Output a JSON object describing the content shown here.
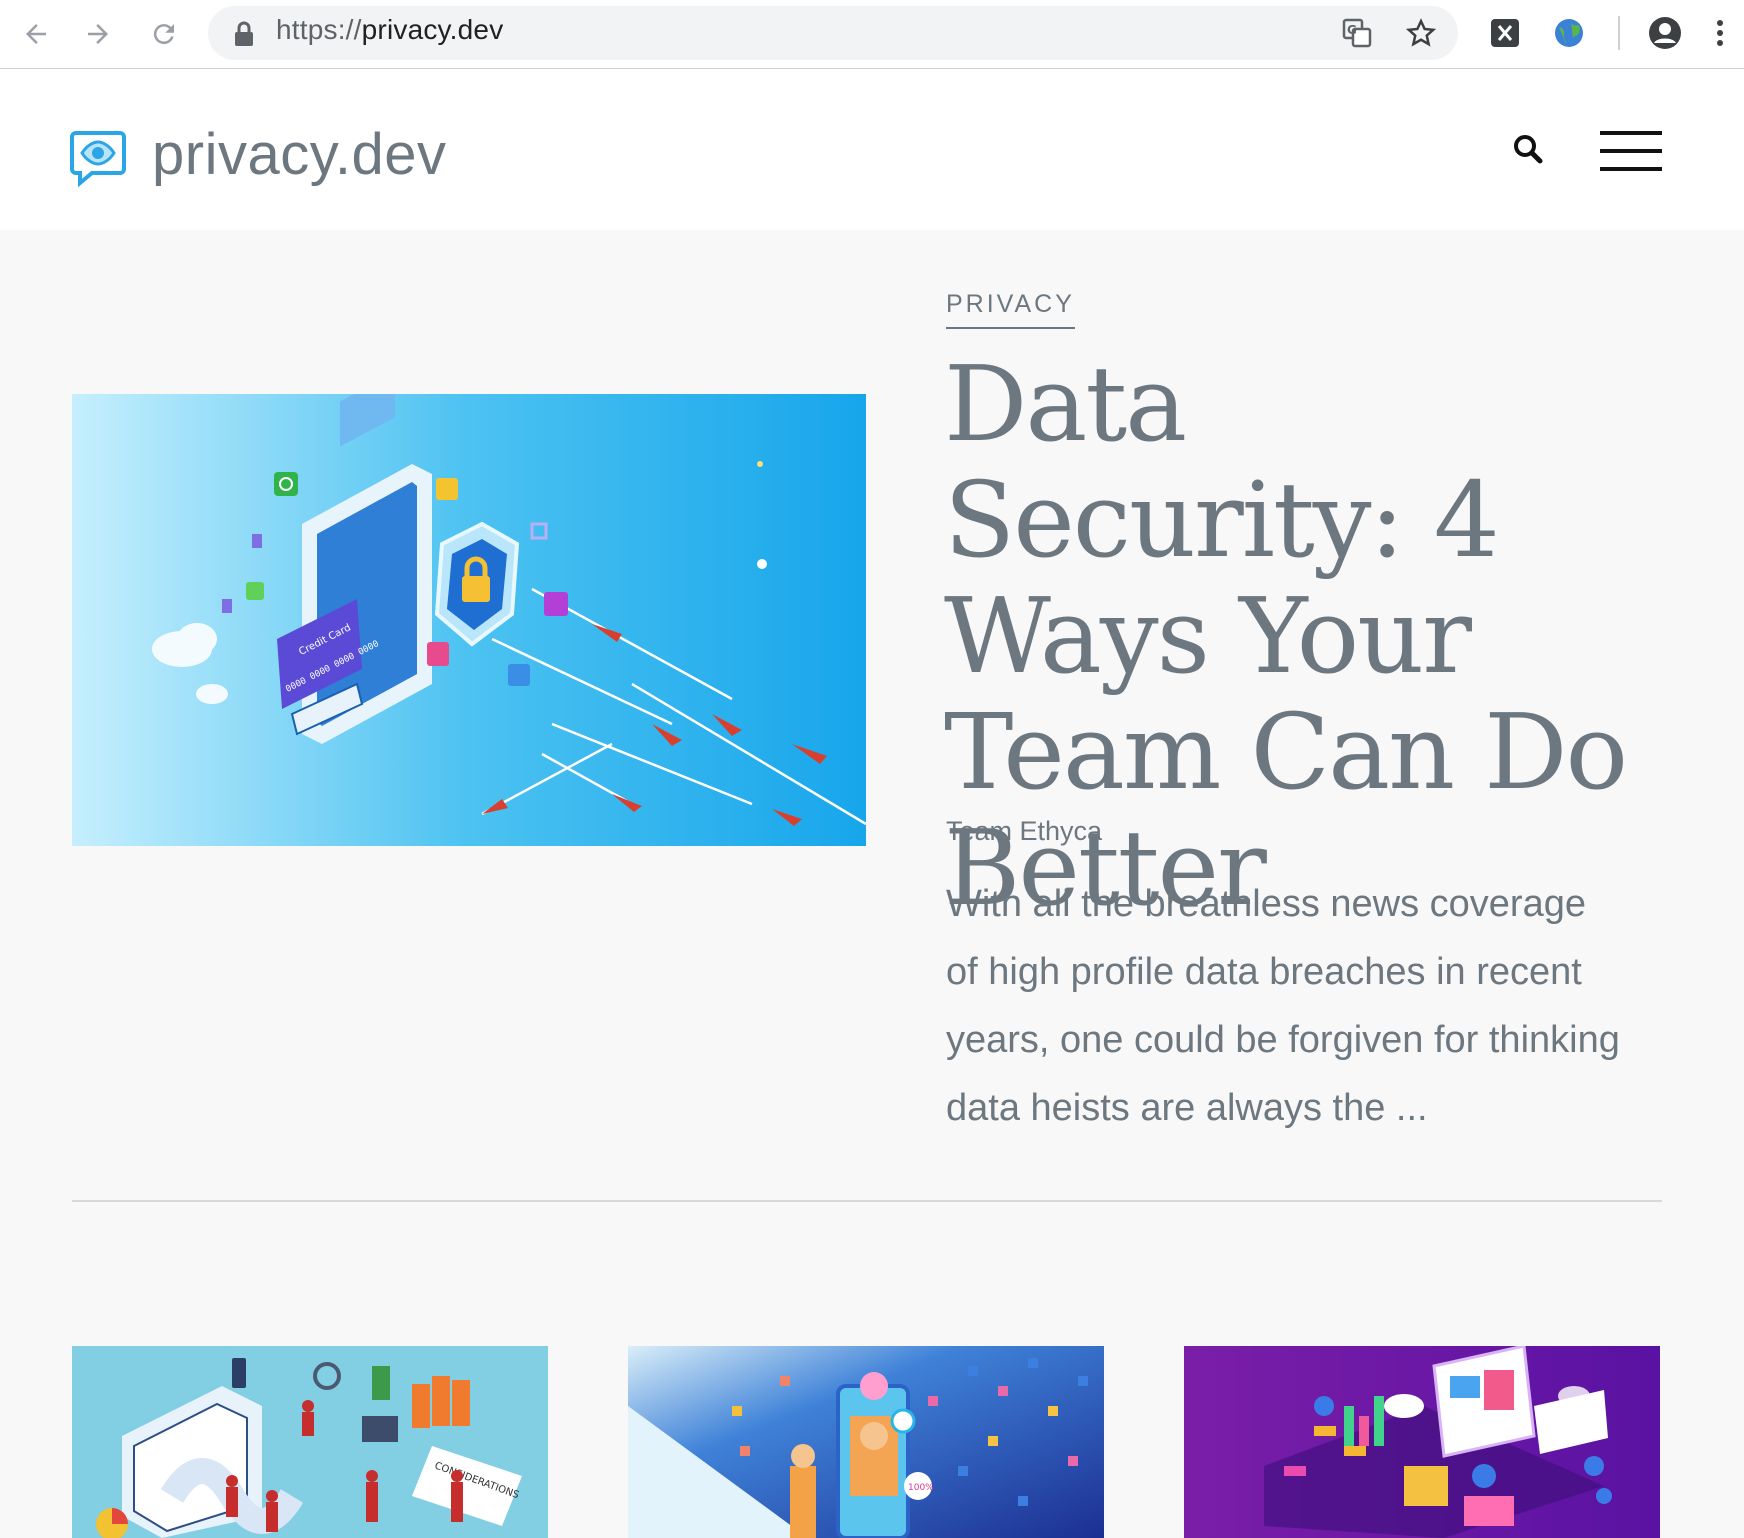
{
  "browser": {
    "url_scheme": "https://",
    "url_host": "privacy.dev"
  },
  "site": {
    "brand": "privacy.dev"
  },
  "hero": {
    "category": "PRIVACY",
    "title": "Data Security: 4 Ways Your Team Can Do Better",
    "author": "Team Ethyca",
    "excerpt": "With all the breathless news coverage of high profile data breaches in recent years, one could be forgiven for thinking data heists are always the ...",
    "image_text": {
      "card": "Credit Card",
      "numbers": "0000 0000 0000 0000"
    }
  },
  "cards": {
    "card1_text": "CONSIDERATIONS",
    "card2_text": "100%"
  },
  "colors": {
    "text": "#6c7780",
    "accent": "#1fa8e6",
    "hero_bg_start": "#bfeafb",
    "hero_bg_end": "#1aa7ec",
    "card1_bg": "#7dcde1",
    "card2_bg": "#1f3fa8",
    "card3_bg": "#6a1aa8"
  },
  "icons": [
    "back-icon",
    "forward-icon",
    "reload-icon",
    "lock-icon",
    "translate-icon",
    "star-icon",
    "x-extension-icon",
    "globe-extension-icon",
    "account-icon",
    "more-icon",
    "logo-icon",
    "search-icon",
    "hamburger-menu-icon"
  ]
}
